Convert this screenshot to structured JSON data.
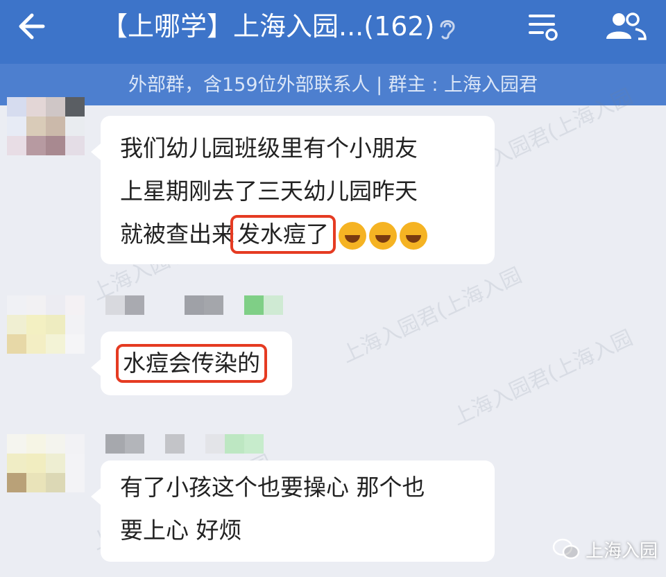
{
  "header": {
    "title": "【上哪学】上海入园...(162)",
    "subtitle": "外部群，含159位外部联系人 | 群主 : 上海入园君"
  },
  "messages": [
    {
      "lines": [
        "我们幼儿园班级里有个小朋友",
        "上星期刚去了三天幼儿园昨天"
      ],
      "last_line_prefix": "就被查出来",
      "highlight": "发水痘了",
      "emoji": [
        "crying-laughing-emoji",
        "crying-laughing-emoji",
        "crying-laughing-emoji"
      ]
    },
    {
      "highlight": "水痘会传染的"
    },
    {
      "lines": [
        "有了小孩这个也要操心 那个也",
        "要上心  好烦"
      ]
    }
  ],
  "watermark": "上海入园君(上海入园",
  "brand": {
    "name": "上海入园"
  },
  "colors": {
    "header": "#3d74c9",
    "subheader": "#4d7fcf",
    "highlight_border": "#e53b22",
    "chat_bg": "#ebedf3"
  }
}
